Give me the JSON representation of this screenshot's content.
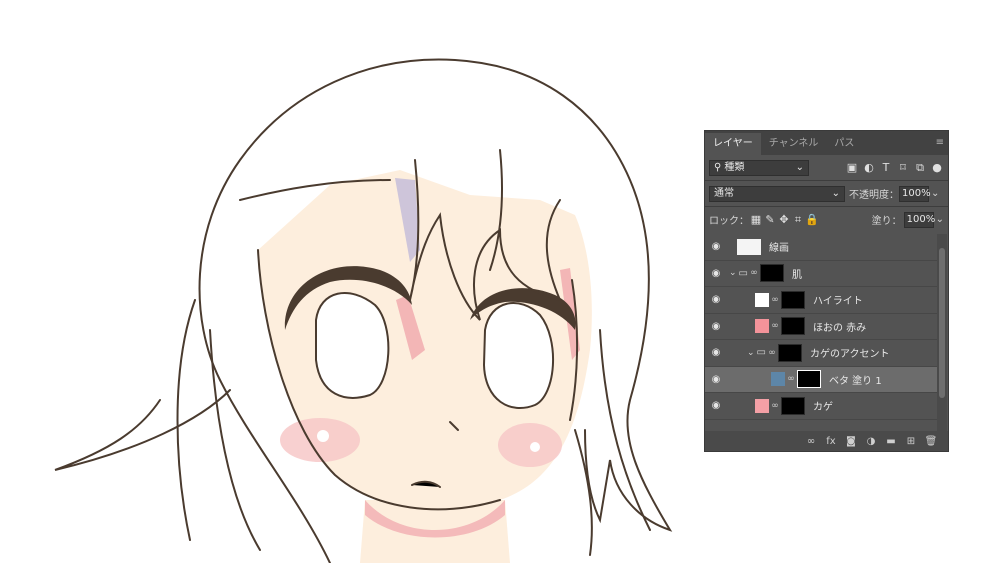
{
  "canvas": {
    "skin_color": "#fdeedd",
    "blush_color": "#f7c8c8",
    "shadow_color": "#f0a8ad",
    "hair_shadow_color": "#b9b4d8",
    "line_color": "#4a3b2f",
    "eyebrow_color": "#4a3b2f"
  },
  "layers_panel": {
    "tabs": [
      {
        "label": "レイヤー",
        "active": true
      },
      {
        "label": "チャンネル",
        "active": false
      },
      {
        "label": "パス",
        "active": false
      }
    ],
    "filter_label": "種類",
    "blend_mode": "通常",
    "opacity_label": "不透明度：",
    "opacity_value": "100%",
    "lock_label": "ロック：",
    "fill_label": "塗り：",
    "fill_value": "100%",
    "layers": [
      {
        "name": "線画",
        "thumb_color": "#f4f4f4",
        "kind": "layer",
        "selected": false,
        "indent": 0
      },
      {
        "name": "肌",
        "thumb_color": "",
        "kind": "group",
        "selected": false,
        "indent": 0
      },
      {
        "name": "ハイライト",
        "thumb_color": "#ffffff",
        "kind": "layer",
        "selected": false,
        "indent": 1
      },
      {
        "name": "ほおの 赤み",
        "thumb_color": "#f3939a",
        "kind": "layer",
        "selected": false,
        "indent": 1
      },
      {
        "name": "カゲのアクセント",
        "thumb_color": "",
        "kind": "group",
        "selected": false,
        "indent": 1
      },
      {
        "name": "ベタ 塗り 1",
        "thumb_color": "#5d86a8",
        "kind": "fill",
        "selected": true,
        "indent": 2
      },
      {
        "name": "カゲ",
        "thumb_color": "#f4a0a6",
        "kind": "layer",
        "selected": false,
        "indent": 1
      }
    ],
    "bottom_icons": [
      "link-icon",
      "fx-icon",
      "mask-icon",
      "adjustment-icon",
      "new-group-icon",
      "new-layer-icon",
      "trash-icon"
    ]
  }
}
